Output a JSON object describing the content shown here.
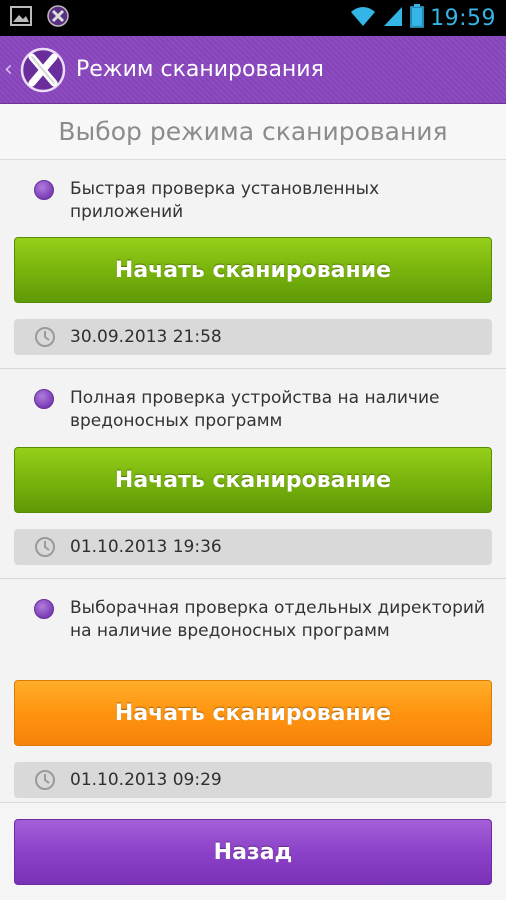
{
  "status_bar": {
    "time": "19:59",
    "icons": [
      "gallery-icon",
      "app-notification-icon",
      "wifi-icon",
      "signal-icon",
      "battery-icon"
    ]
  },
  "action_bar": {
    "title": "Режим сканирования"
  },
  "header": {
    "title": "Выбор режима сканирования"
  },
  "modes": [
    {
      "description": "Быстрая проверка установленных приложений",
      "button_label": "Начать сканирование",
      "button_color": "#79b40d",
      "last_scan": "30.09.2013 21:58"
    },
    {
      "description": "Полная проверка устройства на наличие вредоносных программ",
      "button_label": "Начать сканирование",
      "button_color": "#79b40d",
      "last_scan": "01.10.2013 19:36"
    },
    {
      "description": "Выборачная проверка отдельных директорий на наличие вредоносных программ",
      "button_label": "Начать сканирование",
      "button_color": "#ff9410",
      "last_scan": "01.10.2013 09:29"
    }
  ],
  "footer": {
    "back_label": "Назад",
    "back_color": "#8c42c8"
  },
  "colors": {
    "accent": "#8a46bf",
    "status_time": "#33b5e5"
  }
}
